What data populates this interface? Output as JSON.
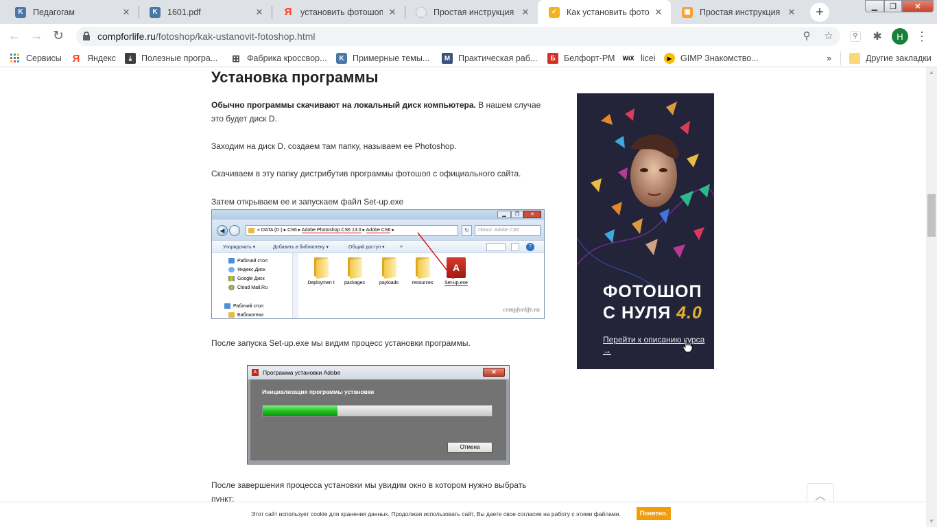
{
  "browser": {
    "tabs": [
      {
        "title": "Педагогам",
        "icon": "vk-icon",
        "color": "#4a76a8"
      },
      {
        "title": "1601.pdf",
        "icon": "vk-icon",
        "color": "#4a76a8"
      },
      {
        "title": "установить фотошоп п...",
        "icon": "yandex-icon",
        "color": "#fc3f1d"
      },
      {
        "title": "Простая инструкция у...",
        "icon": "site-icon",
        "color": "#9aa0a6"
      },
      {
        "title": "Как установить фотош...",
        "icon": "check-icon",
        "color": "#f3b31a"
      },
      {
        "title": "Простая инструкция по...",
        "icon": "site-icon",
        "color": "#f3a33a"
      }
    ],
    "url_host": "compforlife.ru",
    "url_path": "/fotoshop/kak-ustanovit-fotoshop.html",
    "avatar_letter": "Н",
    "bookmarks": [
      {
        "label": "Сервисы",
        "icon": "apps-grid-icon"
      },
      {
        "label": "Яндекс",
        "icon": "yandex-icon"
      },
      {
        "label": "Полезные програ...",
        "icon": "download-icon"
      },
      {
        "label": "Фабрика кроссвор...",
        "icon": "crossword-icon"
      },
      {
        "label": "Примерные темы...",
        "icon": "vk-icon"
      },
      {
        "label": "Практическая раб...",
        "icon": "m-icon"
      },
      {
        "label": "Белфорт-РМ",
        "icon": "b-icon"
      },
      {
        "label": "licei",
        "icon": "wix-icon"
      },
      {
        "label": "GIMP Знакомство...",
        "icon": "play-icon"
      }
    ],
    "bookmarks_more": "»",
    "other_bookmarks": "Другие закладки"
  },
  "article": {
    "heading": "Установка программы",
    "p1_bold": "Обычно программы скачивают на локальный диск компьютера.",
    "p1_rest": " В нашем случае это будет диск D.",
    "p2": "Заходим на диск D, создаем там папку, называем ее Photoshop.",
    "p3": "Скачиваем в эту папку дистрибутив программы фотошоп с официального сайта.",
    "p4": "Затем открываем ее и запускаем файл Set-up.exe",
    "p5": "После запуска Set-up.exe мы видим процесс установки программы.",
    "p6": "После завершения процесса установки мы увидим окно в котором нужно выбрать пункт:"
  },
  "explorer": {
    "breadcrumb": [
      "«",
      "DATA (D:)",
      "CS6",
      "Adobe Photoshop CS6 13.0",
      "Adobe CS6"
    ],
    "search_placeholder": "Поиск: Adobe CS6",
    "commands": [
      "Упорядочить ▾",
      "Добавить в библиотеку ▾",
      "Общий доступ ▾",
      "»"
    ],
    "tree": [
      "Рабочий стол",
      "Яндекс.Диск",
      "Google Диск",
      "Cloud Mail.Ru",
      "Рабочий стол",
      "Библиотеки"
    ],
    "files": [
      "Deploymen t",
      "packages",
      "payloads",
      "resources",
      "Set-up.exe"
    ],
    "watermark": "compforlife.ru"
  },
  "installer": {
    "title": "Программа установки Adobe",
    "heading": "Инициализация программы установки",
    "progress": 0.325,
    "cancel": "Отмена"
  },
  "ad": {
    "title_line1": "ФОТОШОП",
    "title_line2": "С НУЛЯ",
    "version": "4.0",
    "link": "Перейти к описанию курса →"
  },
  "cookie": {
    "text": "Этот сайт использует cookie для хранения данных. Продолжая использовать сайт, Вы даете свое согласие на работу с этими файлами.",
    "button": "Понятно."
  }
}
